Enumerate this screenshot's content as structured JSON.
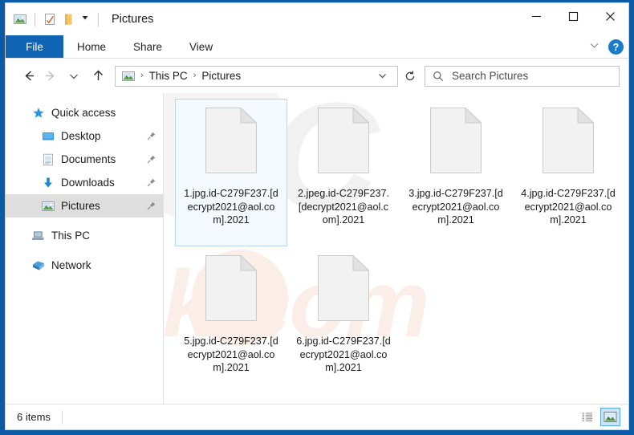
{
  "window": {
    "title": "Pictures",
    "quick_access_icons": [
      "picture-icon",
      "checkmark-document-icon",
      "folder-icon",
      "dropdown-arrow-icon"
    ],
    "controls": {
      "minimize": "minimize-button",
      "maximize": "maximize-button",
      "close": "close-button"
    }
  },
  "ribbon": {
    "tabs": [
      {
        "label": "File",
        "active": true
      },
      {
        "label": "Home",
        "active": false
      },
      {
        "label": "Share",
        "active": false
      },
      {
        "label": "View",
        "active": false
      }
    ],
    "expand_label": "",
    "help_label": "?"
  },
  "address": {
    "back": "back-button",
    "forward": "forward-button",
    "recent": "recent-locations-button",
    "up": "up-button",
    "breadcrumbs": [
      "This PC",
      "Pictures"
    ],
    "separator": "›",
    "refresh": "refresh-button"
  },
  "search": {
    "placeholder": "Search Pictures",
    "value": ""
  },
  "sidebar": {
    "items": [
      {
        "label": "Quick access",
        "icon": "star-icon",
        "level": 1,
        "pinned": false,
        "selected": false
      },
      {
        "label": "Desktop",
        "icon": "desktop-icon",
        "level": 2,
        "pinned": true,
        "selected": false
      },
      {
        "label": "Documents",
        "icon": "documents-icon",
        "level": 2,
        "pinned": true,
        "selected": false
      },
      {
        "label": "Downloads",
        "icon": "downloads-icon",
        "level": 2,
        "pinned": true,
        "selected": false
      },
      {
        "label": "Pictures",
        "icon": "pictures-icon",
        "level": 2,
        "pinned": true,
        "selected": true
      },
      {
        "label": "This PC",
        "icon": "this-pc-icon",
        "level": 1,
        "pinned": false,
        "selected": false
      },
      {
        "label": "Network",
        "icon": "network-icon",
        "level": 1,
        "pinned": false,
        "selected": false
      }
    ]
  },
  "files": [
    {
      "name": "1.jpg.id-C279F237.[decrypt2021@aol.com].2021",
      "selected": true
    },
    {
      "name": "2.jpeg.id-C279F237.[decrypt2021@aol.com].2021",
      "selected": false
    },
    {
      "name": "3.jpg.id-C279F237.[decrypt2021@aol.com].2021",
      "selected": false
    },
    {
      "name": "4.jpg.id-C279F237.[decrypt2021@aol.com].2021",
      "selected": false
    },
    {
      "name": "5.jpg.id-C279F237.[decrypt2021@aol.com].2021",
      "selected": false
    },
    {
      "name": "6.jpg.id-C279F237.[decrypt2021@aol.com].2021",
      "selected": false
    }
  ],
  "watermark": {
    "top": "PC",
    "bottom": "risk.com"
  },
  "status": {
    "item_count": "6 items",
    "details_view": "details-view-button",
    "large_icons_view": "large-icons-view-button"
  },
  "colors": {
    "accent": "#0f64b4",
    "window_border": "#0a5aa5",
    "selection_fill": "#f4f9fe",
    "selection_border": "#b8d6f0",
    "sidebar_selected": "#dedede"
  }
}
